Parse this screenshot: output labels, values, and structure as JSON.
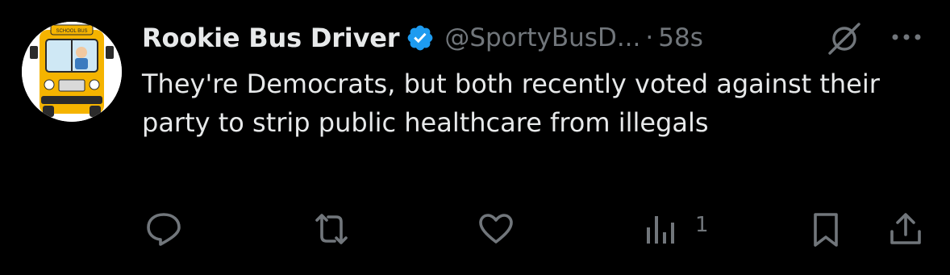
{
  "author": {
    "display_name": "Rookie Bus Driver",
    "handle": "@SportyBusD...",
    "separator": "·",
    "timestamp": "58s",
    "verified": true,
    "avatar_sign_text": "SCHOOL BUS"
  },
  "tweet": {
    "text": "They're Democrats, but both recently voted against their party to strip public healthcare from illegals"
  },
  "actions": {
    "reply_icon": "reply-bubble",
    "retweet_icon": "retweet-arrows",
    "like_icon": "heart",
    "views_icon": "bar-chart",
    "views_count": "1",
    "bookmark_icon": "bookmark",
    "share_icon": "upload-arrow"
  },
  "colors": {
    "background": "#000000",
    "text_primary": "#e7e9ea",
    "text_secondary": "#71767b",
    "verified_blue": "#1d9bf0"
  }
}
